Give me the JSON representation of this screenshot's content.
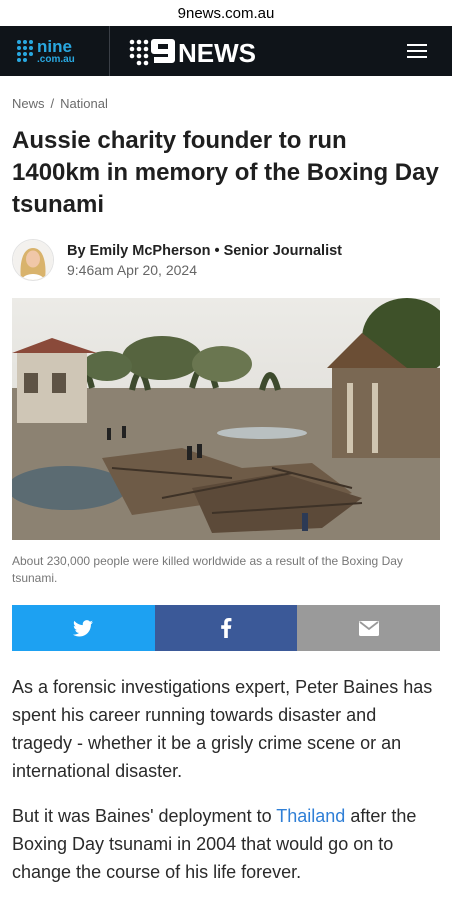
{
  "browser": {
    "url": "9news.com.au"
  },
  "header": {
    "nine_logo_top": "nine",
    "nine_logo_bottom": ".com.au",
    "news_logo": "NEWS"
  },
  "breadcrumb": {
    "first": "News",
    "separator": "/",
    "second": "National"
  },
  "article": {
    "title": "Aussie charity founder to run 1400km in memory of the Boxing Day tsunami",
    "author_line": "By Emily McPherson • Senior Journalist",
    "timestamp": "9:46am Apr 20, 2024",
    "caption": "About 230,000 people were killed worldwide as a result of the Boxing Day tsunami.",
    "p1": "As a forensic investigations expert, Peter Baines has spent his career running towards disaster and tragedy - whether it be a grisly crime scene or an international disaster.",
    "p2_before": "But it was Baines' deployment to ",
    "p2_link": "Thailand",
    "p2_after": " after the Boxing Day tsunami in 2004 that would go on to change the course of his life forever."
  },
  "share": {
    "icons": [
      "twitter-icon",
      "facebook-icon",
      "email-icon"
    ]
  },
  "colors": {
    "nav_bg": "#0f1419",
    "nine_blue": "#29a8e0",
    "twitter": "#1da1f2",
    "facebook": "#3b5998",
    "email": "#9a9a9a",
    "link": "#2f7fd6"
  }
}
